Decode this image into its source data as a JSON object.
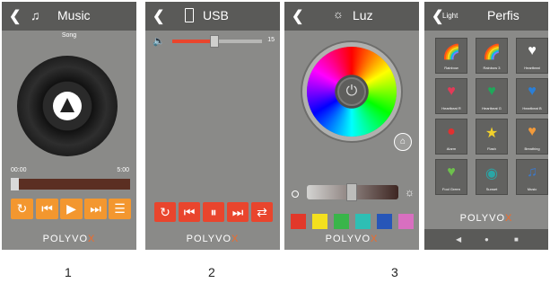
{
  "screen1": {
    "title": "Music",
    "subtitle": "Song",
    "time_start": "00:00",
    "time_end": "5:00",
    "progress": 0.0,
    "logo_main": "POLYVO",
    "logo_x": "X",
    "icons": [
      "back-icon",
      "music-note-icon",
      "repeat-icon",
      "previous-icon",
      "play-icon",
      "next-icon",
      "playlist-icon"
    ],
    "accent": "#f3972f"
  },
  "screen2": {
    "title": "USB",
    "volume_value": "15",
    "volume_fraction": 0.33,
    "logo_main": "POLYVO",
    "logo_x": "X",
    "icons": [
      "back-icon",
      "usb-icon",
      "volume-icon",
      "repeat-icon",
      "previous-icon",
      "pause-icon",
      "next-icon",
      "shuffle-icon"
    ],
    "accent": "#e9452d"
  },
  "screen3": {
    "title": "Luz",
    "brightness_fraction": 0.45,
    "logo_main": "POLYVO",
    "logo_x": "X",
    "swatches": [
      "#e2382a",
      "#f4e01e",
      "#39b54a",
      "#2ebfb4",
      "#2756b8",
      "#d86fc0"
    ],
    "icons": [
      "back-icon",
      "bulb-icon",
      "power-icon",
      "home-icon",
      "brightness-low-icon",
      "brightness-high-icon"
    ]
  },
  "screen4": {
    "back_label": "Light",
    "title": "Perfis",
    "tiles": [
      {
        "label": "Rainbow",
        "icon": "🌈",
        "color": "#e58bc4"
      },
      {
        "label": "Rainbow 3",
        "icon": "🌈",
        "color": "#e9803a"
      },
      {
        "label": "Heartbeat",
        "icon": "♥",
        "color": "#ffffff"
      },
      {
        "label": "Heartbeat R",
        "icon": "♥",
        "color": "#e33a57"
      },
      {
        "label": "Heartbeat G",
        "icon": "♥",
        "color": "#1fa85a"
      },
      {
        "label": "Heartbeat B",
        "icon": "♥",
        "color": "#2a7fd8"
      },
      {
        "label": "Alarm",
        "icon": "●",
        "color": "#e23030"
      },
      {
        "label": "Flash",
        "icon": "★",
        "color": "#f2d12b"
      },
      {
        "label": "Breathing",
        "icon": "♥",
        "color": "#f29a3a"
      },
      {
        "label": "Fool Green",
        "icon": "♥",
        "color": "#6dc04c"
      },
      {
        "label": "Sunset",
        "icon": "◉",
        "color": "#2aa6a6"
      },
      {
        "label": "Music",
        "icon": "♫",
        "color": "#3d78c8"
      }
    ],
    "logo_main": "POLYVO",
    "logo_x": "X",
    "nav_icons": [
      "nav-back-icon",
      "nav-home-icon",
      "nav-recents-icon"
    ]
  },
  "labels": [
    "1",
    "2",
    "3"
  ]
}
